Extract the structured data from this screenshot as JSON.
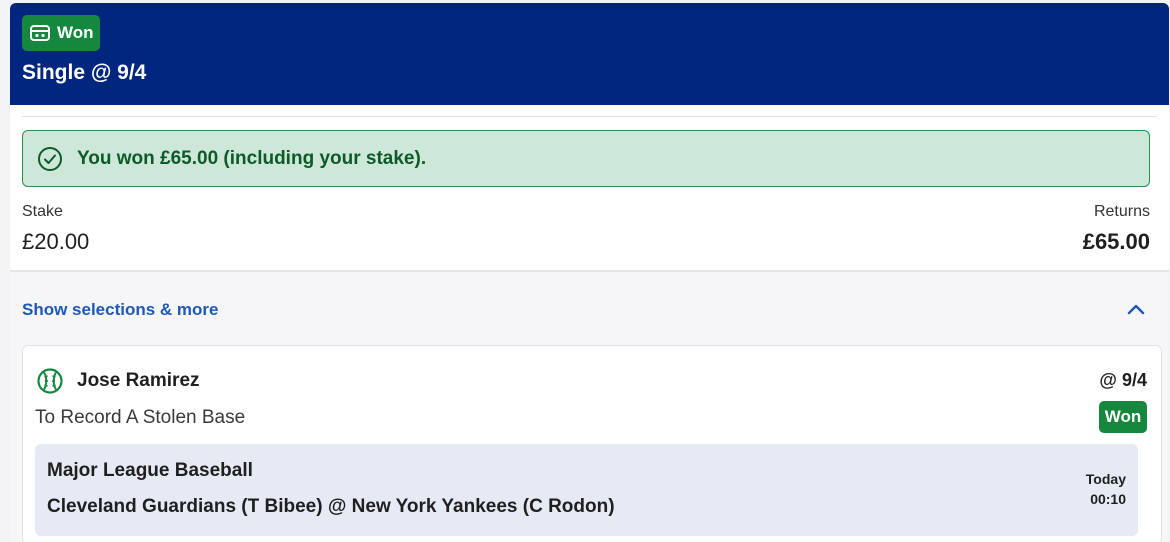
{
  "header": {
    "status_label": "Won",
    "bet_title": "Single @ 9/4",
    "status_icon": "ticket-icon",
    "background_color": "#01267f",
    "status_color": "#16873f"
  },
  "win_banner": {
    "icon": "check-circle-icon",
    "message": "You won £65.00 (including your stake)."
  },
  "summary": {
    "stake_label": "Stake",
    "stake_value": "£20.00",
    "returns_label": "Returns",
    "returns_value": "£65.00"
  },
  "selections_toggle": {
    "label": "Show selections & more",
    "icon": "chevron-up-icon",
    "link_color": "#1f58b8"
  },
  "selection": {
    "sport_icon": "baseball-icon",
    "player": "Jose Ramirez",
    "odds": "@ 9/4",
    "market": "To Record A Stolen Base",
    "status": "Won",
    "event": {
      "league": "Major League Baseball",
      "matchup": "Cleveland Guardians (T Bibee) @ New York Yankees (C Rodon)",
      "day": "Today",
      "time": "00:10"
    }
  }
}
